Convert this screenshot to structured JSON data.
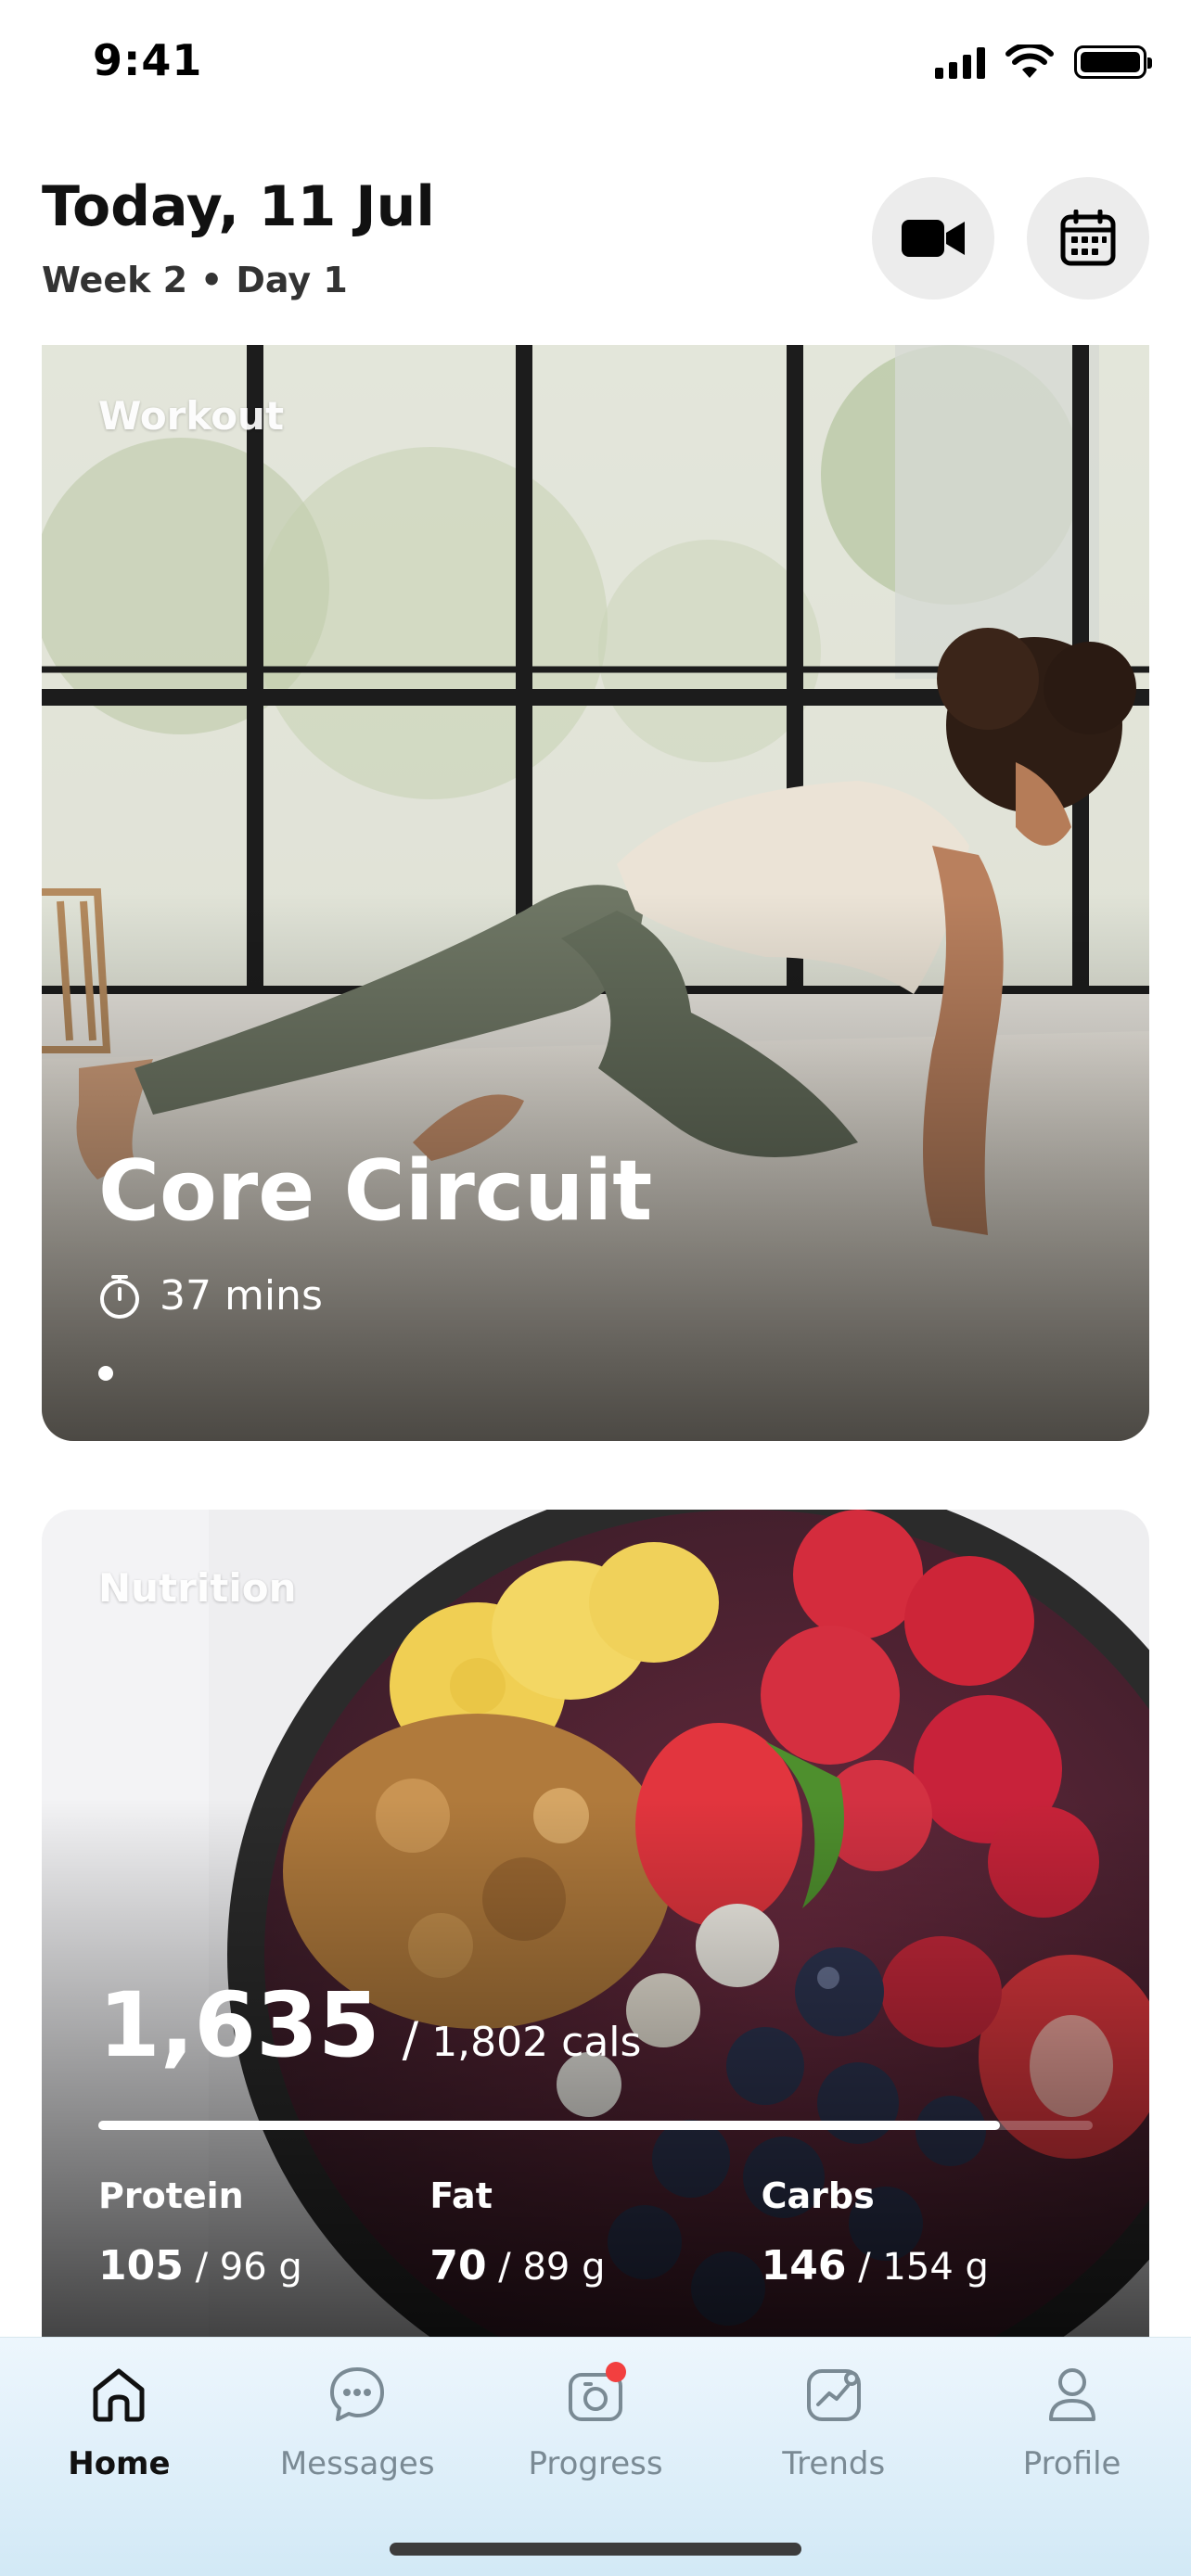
{
  "status_bar": {
    "time": "9:41"
  },
  "header": {
    "title": "Today, 11 Jul",
    "week": "Week 2",
    "day": "Day 1",
    "separator": "•"
  },
  "workout": {
    "label": "Workout",
    "title": "Core Circuit",
    "duration": "37 mins",
    "carousel_index": 1
  },
  "nutrition": {
    "label": "Nutrition",
    "calories": {
      "current": "1,635",
      "separator": "/",
      "goal": "1,802 cals",
      "progress": 0.907
    },
    "macros": [
      {
        "name": "Protein",
        "value": "105",
        "goal": "/ 96 g"
      },
      {
        "name": "Fat",
        "value": "70",
        "goal": "/ 89 g"
      },
      {
        "name": "Carbs",
        "value": "146",
        "goal": "/ 154 g"
      }
    ]
  },
  "tabs": [
    {
      "label": "Home",
      "icon": "home-icon",
      "active": true
    },
    {
      "label": "Messages",
      "icon": "chat-icon",
      "active": false
    },
    {
      "label": "Progress",
      "icon": "camera-icon",
      "active": false,
      "badge": true
    },
    {
      "label": "Trends",
      "icon": "trends-icon",
      "active": false
    },
    {
      "label": "Profile",
      "icon": "profile-icon",
      "active": false
    }
  ],
  "colors": {
    "badge": "#f23f3f",
    "tab_bar": "#e3f1fa",
    "header_button": "#ececec"
  }
}
